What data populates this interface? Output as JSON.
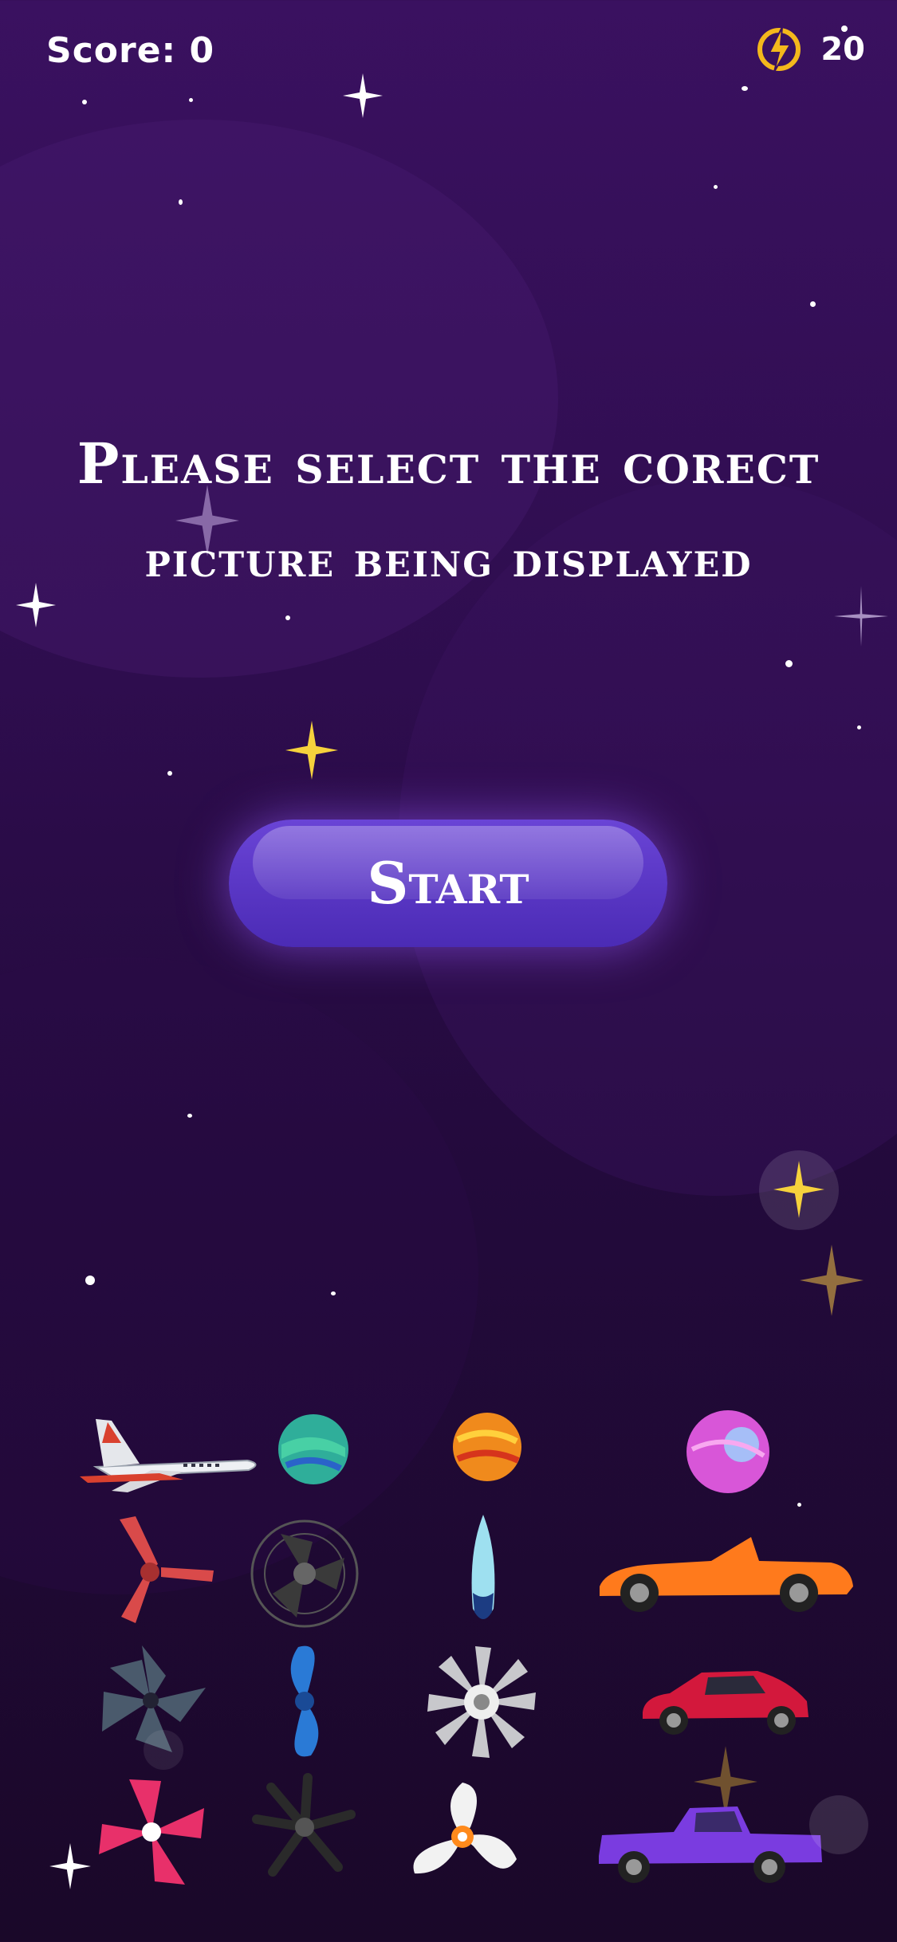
{
  "hud": {
    "score_label": "Score: 0",
    "energy_value": "20"
  },
  "title": {
    "line1": "Please select the corect",
    "line2": "picture being displayed"
  },
  "start_button": {
    "label": "Start"
  },
  "grid_items": [
    {
      "name": "airplane-icon"
    },
    {
      "name": "green-planet-icon"
    },
    {
      "name": "orange-planet-icon"
    },
    {
      "name": "pink-planet-icon"
    },
    {
      "name": "red-propeller-icon"
    },
    {
      "name": "fan-icon"
    },
    {
      "name": "surfboard-icon"
    },
    {
      "name": "orange-convertible-icon"
    },
    {
      "name": "gray-propeller-icon"
    },
    {
      "name": "blue-propeller-icon"
    },
    {
      "name": "turbine-icon"
    },
    {
      "name": "red-hatchback-icon"
    },
    {
      "name": "pink-propeller-icon"
    },
    {
      "name": "black-propeller-icon"
    },
    {
      "name": "white-propeller-icon"
    },
    {
      "name": "purple-pickup-icon"
    }
  ]
}
